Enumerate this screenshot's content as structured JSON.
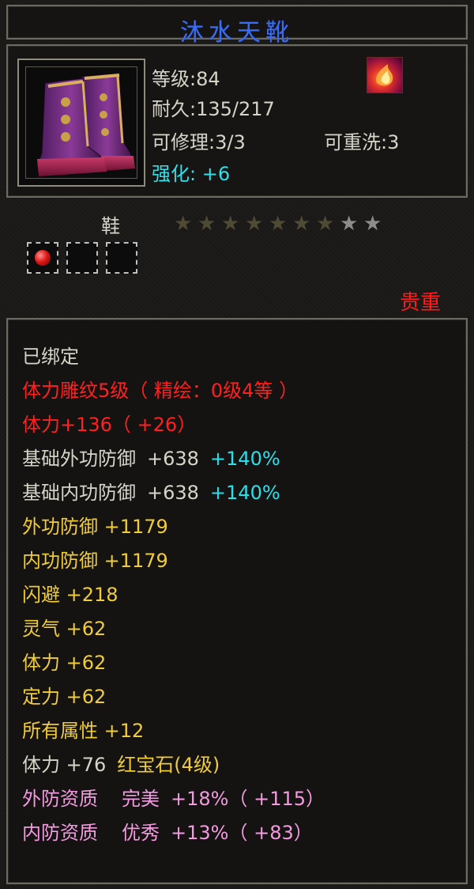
{
  "item": {
    "name": "沐水天靴",
    "level": "等级:84",
    "durability": "耐久:135/217",
    "repairable": "可修理:3/3",
    "rewashable": "可重洗:3",
    "enhance": "强化: +6",
    "type": "鞋",
    "rarity": "贵重",
    "stars_lit": 7,
    "stars_total": 9
  },
  "attributes": {
    "bound": "已绑定",
    "engrave": "体力雕纹5级（ 精绘：0级4等 ）",
    "stamina_main": "体力+136（ +26）",
    "base_ext_def_label": "基础外功防御",
    "base_ext_def_value": "+638",
    "base_ext_def_pct": "+140%",
    "base_int_def_label": "基础内功防御",
    "base_int_def_value": "+638",
    "base_int_def_pct": "+140%",
    "ext_def": "外功防御 +1179",
    "int_def": "内功防御 +1179",
    "dodge": "闪避 +218",
    "spirit": "灵气 +62",
    "stamina": "体力 +62",
    "focus": "定力 +62",
    "all_attr": "所有属性 +12",
    "gem_stat": "体力 +76",
    "gem_name": "红宝石(4级)",
    "ext_quality_label": "外防资质",
    "ext_quality_grade": "完美",
    "ext_quality_value": "+18%（ +115）",
    "int_quality_label": "内防资质",
    "int_quality_grade": "优秀",
    "int_quality_value": "+13%（ +83）"
  },
  "colors": {
    "title": "#3b6cf0",
    "rarity": "#ff1c1c",
    "yellow_attr": "#f0cc38",
    "cyan_attr": "#27e0ea",
    "pink_attr": "#f39ae0"
  }
}
